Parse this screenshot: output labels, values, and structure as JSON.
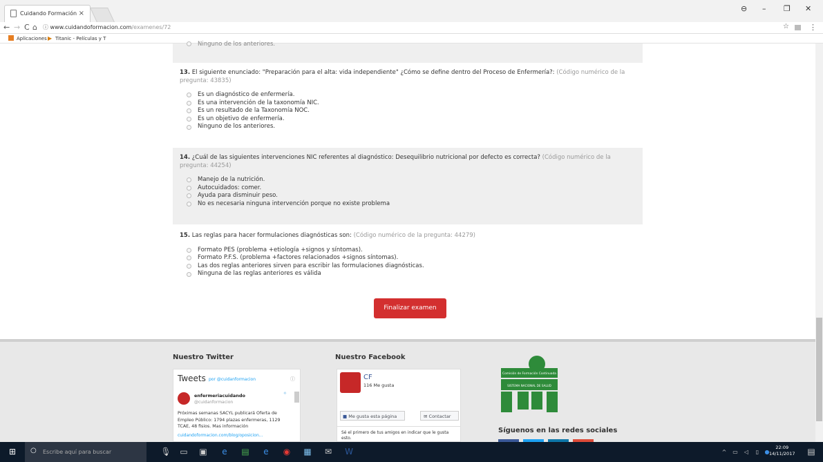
{
  "browser": {
    "tab_title": "Cuidando Formación",
    "tab_close": "×",
    "url_domain": "www.cuidandoformacion.com",
    "url_path": "/examenes/72",
    "bookmarks": [
      {
        "label": "Aplicaciones"
      },
      {
        "label": "Titanic - Películas y T"
      }
    ]
  },
  "exam": {
    "prev_last_option": "Ninguno de los anteriores.",
    "questions": [
      {
        "num": "13.",
        "text": "El siguiente enunciado: \"Preparación para el alta: vida independiente\" ¿Cómo se define dentro del Proceso de Enfermería?:",
        "code": "(Código numérico de la pregunta: 43835)",
        "options": [
          "Es un diagnóstico de enfermería.",
          "Es una intervención de la taxonomía NIC.",
          "Es un resultado de la Taxonomía NOC.",
          "Es un objetivo de enfermería.",
          "Ninguno de los anteriores."
        ]
      },
      {
        "num": "14.",
        "text": "¿Cuál de las siguientes intervenciones NIC referentes al diagnóstico: Desequilibrio nutricional por defecto es correcta?",
        "code": "(Código numérico de la pregunta: 44254)",
        "options": [
          "Manejo de la nutrición.",
          "Autocuidados: comer.",
          "Ayuda para disminuir peso.",
          "No es necesaria ninguna intervención porque no existe problema"
        ]
      },
      {
        "num": "15.",
        "text": "Las reglas para hacer formulaciones diagnósticas son:",
        "code": "(Código numérico de la pregunta: 44279)",
        "options": [
          "Formato PES (problema +etiología +signos y síntomas).",
          "Formato P.F.S. (problema +factores relacionados +signos síntomas).",
          "Las dos reglas anteriores sirven para escribir las formulaciones diagnósticas.",
          "Ninguna de las reglas anteriores es válida"
        ]
      }
    ],
    "finish_button": "Finalizar examen"
  },
  "footer": {
    "twitter_title": "Nuestro Twitter",
    "tweets_label": "Tweets",
    "tweets_by": "por @cuidanformacion",
    "tweet_user": "enfermeriacuidando",
    "tweet_handle": "@cuidanformacion",
    "tweet_text": "Próximas semanas SACYL publicará Oferta de Empleo Público: 1794 plazas enfermeras, 1129 TCAE, 48 fisios. Mas información",
    "tweet_link": "cuidandoformacion.com/blog/oposicion...",
    "facebook_title": "Nuestro Facebook",
    "fb_page": "CF",
    "fb_likes": "116 Me gusta",
    "fb_like_button": "Me gusta esta página",
    "fb_contact_button": "Contactar",
    "fb_friends_text": "Sé el primero de tus amigos en indicar que le gusta esto.",
    "logo_top": "Comisión de Formación Continuada",
    "logo_bottom": "SISTEMA NACIONAL DE SALUD",
    "social_title": "Síguenos en las redes sociales",
    "social_colors": [
      "#3b5998",
      "#1da1f2",
      "#0e76a8",
      "#dd4b39"
    ]
  },
  "taskbar": {
    "search_placeholder": "Escribe aquí para buscar",
    "time": "22:09",
    "date": "14/11/2017"
  }
}
